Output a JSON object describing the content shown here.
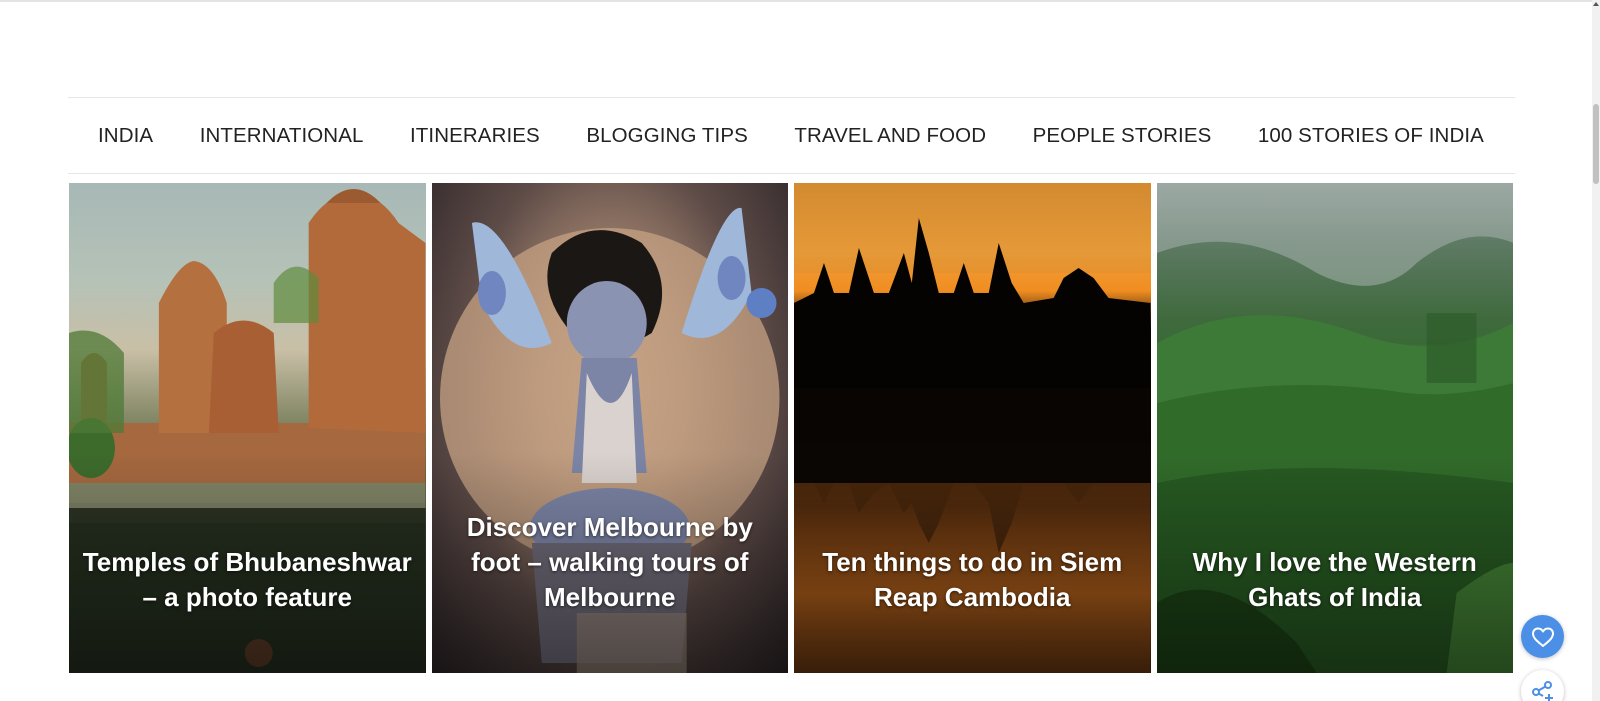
{
  "nav": {
    "items": [
      {
        "label": "INDIA"
      },
      {
        "label": "INTERNATIONAL"
      },
      {
        "label": "ITINERARIES"
      },
      {
        "label": "BLOGGING TIPS"
      },
      {
        "label": "TRAVEL AND FOOD"
      },
      {
        "label": "PEOPLE STORIES"
      },
      {
        "label": "100 STORIES OF INDIA"
      }
    ]
  },
  "cards": [
    {
      "title": "Temples of Bhubaneshwar – a photo feature"
    },
    {
      "title": "Discover Melbourne by foot – walking tours of Melbourne"
    },
    {
      "title": "Ten things to do in Siem Reap Cambodia"
    },
    {
      "title": "Why I love the Western Ghats of India"
    }
  ],
  "floating": {
    "like_icon": "heart-icon",
    "share_icon": "share-icon",
    "accent": "#4b8fe6"
  }
}
